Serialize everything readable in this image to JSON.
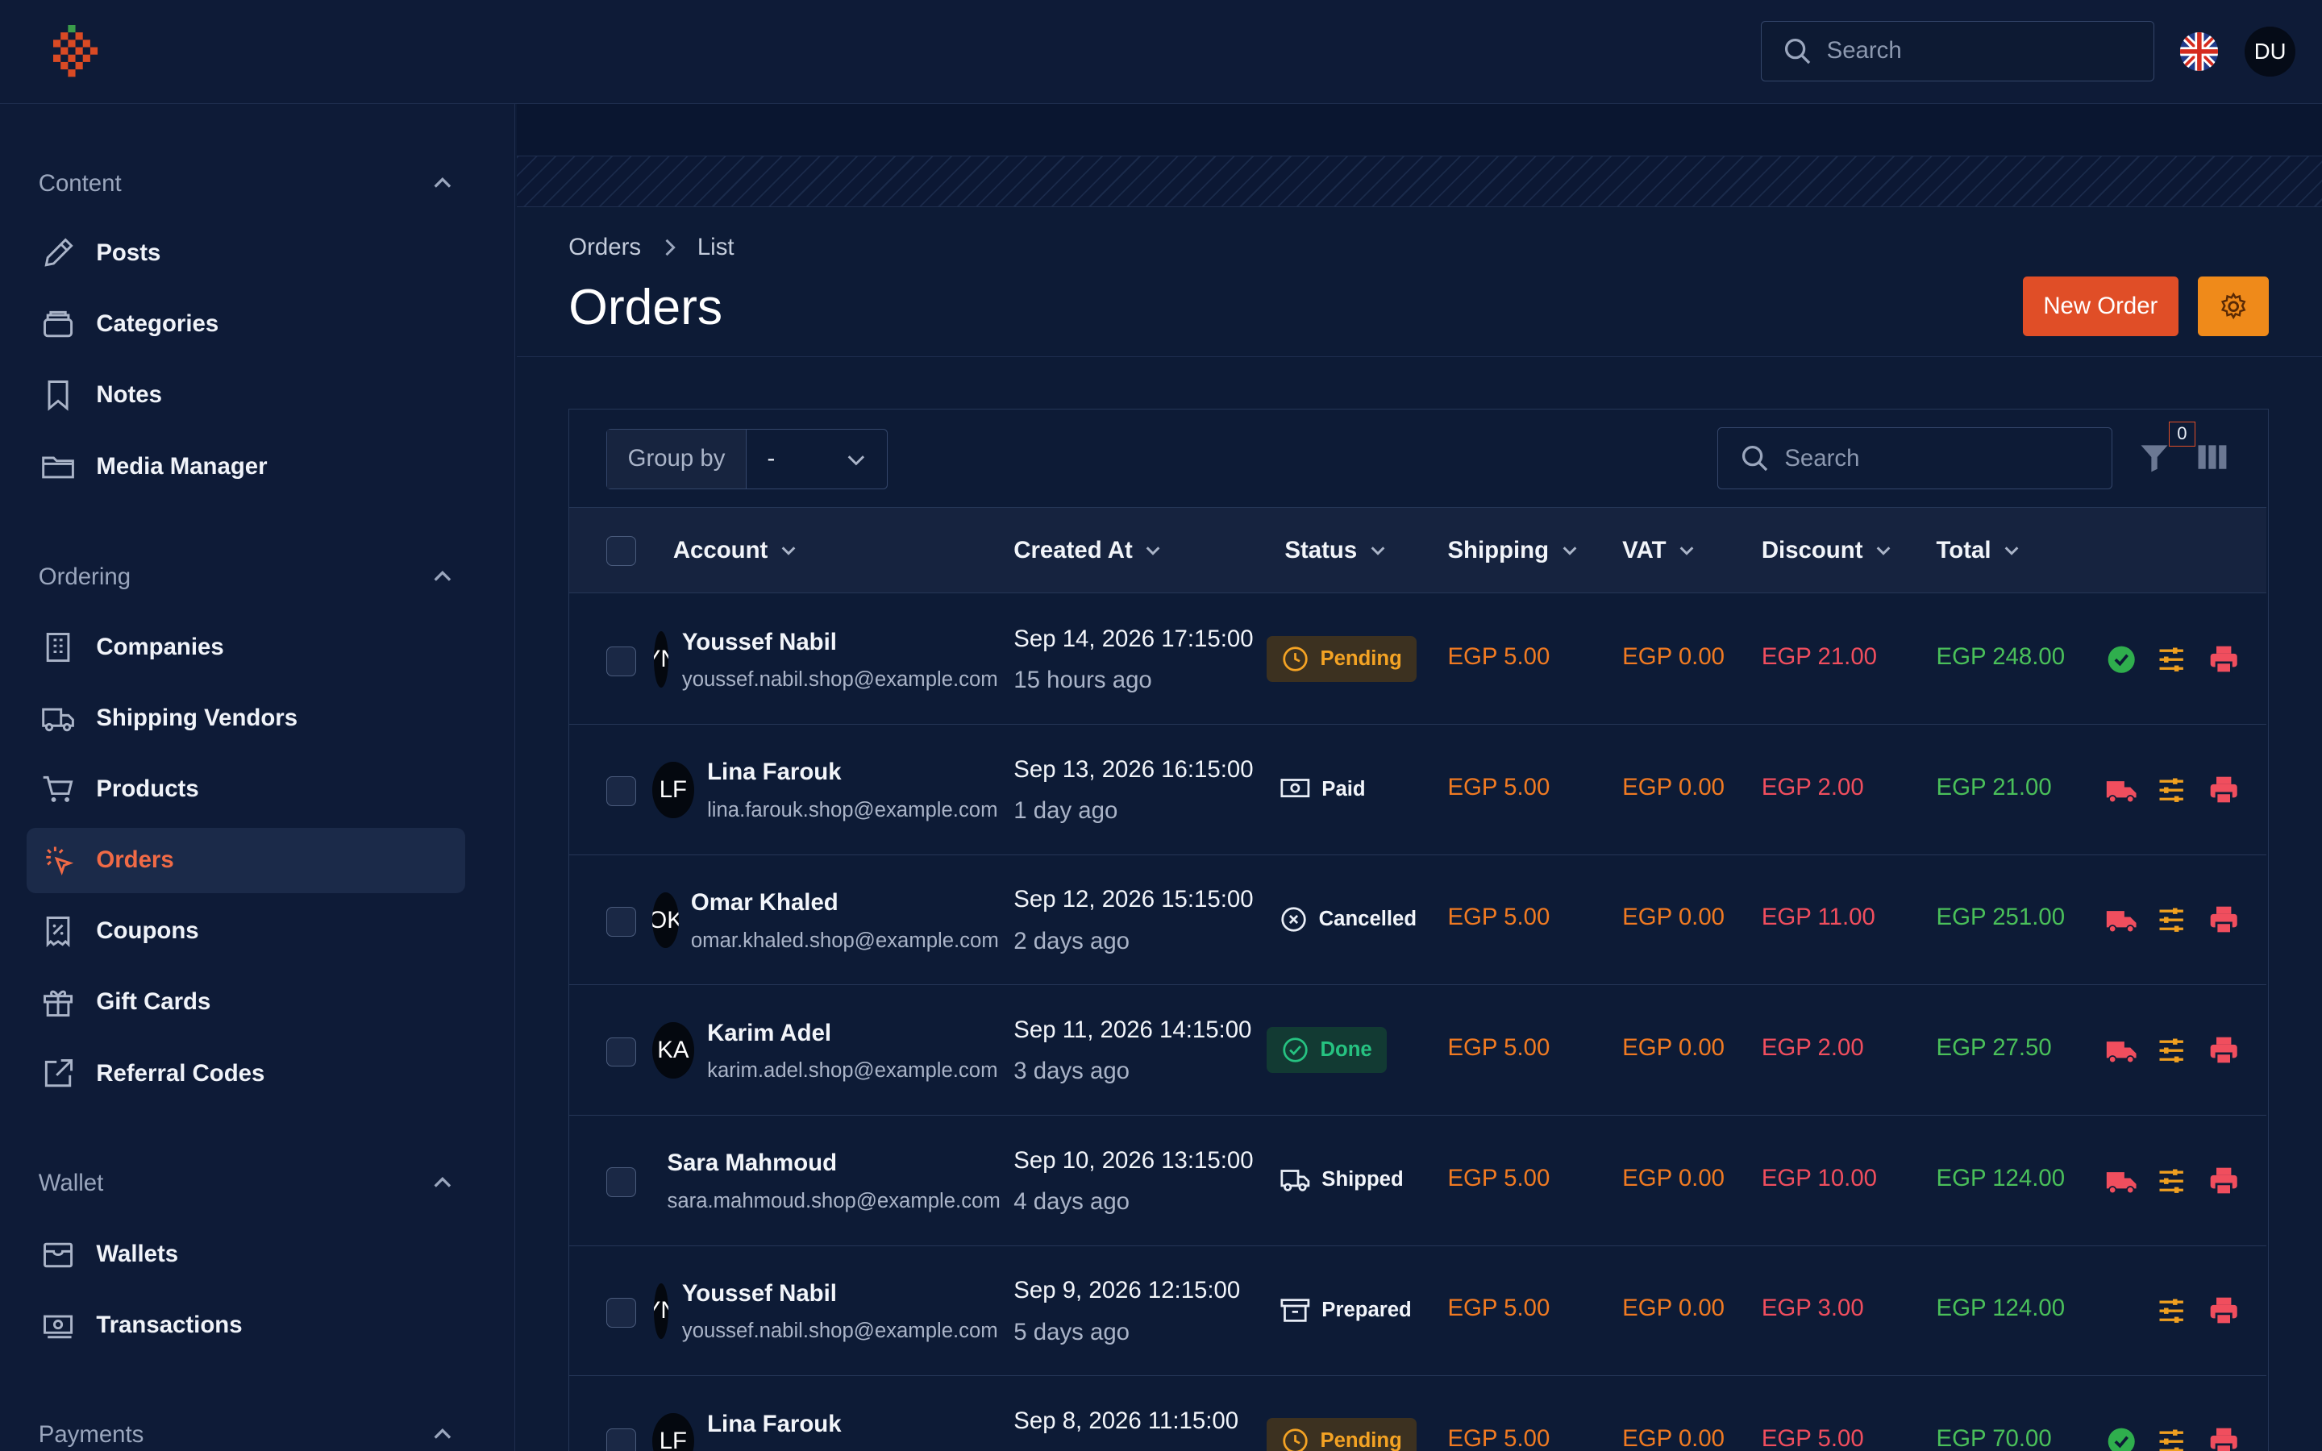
{
  "topbar": {
    "search_placeholder": "Search",
    "user_initials": "DU"
  },
  "sidebar": {
    "groups": [
      {
        "label": "Content",
        "items": [
          "Posts",
          "Categories",
          "Notes",
          "Media Manager"
        ]
      },
      {
        "label": "Ordering",
        "items": [
          "Companies",
          "Shipping Vendors",
          "Products",
          "Orders",
          "Coupons",
          "Gift Cards",
          "Referral Codes"
        ]
      },
      {
        "label": "Wallet",
        "items": [
          "Wallets",
          "Transactions"
        ]
      },
      {
        "label": "Payments",
        "items": []
      }
    ],
    "active_item": "Orders"
  },
  "breadcrumb": [
    "Orders",
    "List"
  ],
  "page_title": "Orders",
  "actions": {
    "new_order_label": "New Order"
  },
  "table": {
    "group_by_label": "Group by",
    "group_by_value": "-",
    "search_placeholder": "Search",
    "filter_count": "0",
    "columns": [
      "Account",
      "Created At",
      "Status",
      "Shipping",
      "VAT",
      "Discount",
      "Total"
    ],
    "rows": [
      {
        "avatar": "YN",
        "name": "Youssef Nabil",
        "email": "youssef.nabil.shop@example.com",
        "created": "Sep 14, 2026 17:15:00",
        "ago": "15 hours ago",
        "status": "Pending",
        "shipping": "EGP 5.00",
        "vat": "EGP 0.00",
        "discount": "EGP 21.00",
        "total": "EGP 248.00"
      },
      {
        "avatar": "LF",
        "name": "Lina Farouk",
        "email": "lina.farouk.shop@example.com",
        "created": "Sep 13, 2026 16:15:00",
        "ago": "1 day ago",
        "status": "Paid",
        "shipping": "EGP 5.00",
        "vat": "EGP 0.00",
        "discount": "EGP 2.00",
        "total": "EGP 21.00"
      },
      {
        "avatar": "OK",
        "name": "Omar Khaled",
        "email": "omar.khaled.shop@example.com",
        "created": "Sep 12, 2026 15:15:00",
        "ago": "2 days ago",
        "status": "Cancelled",
        "shipping": "EGP 5.00",
        "vat": "EGP 0.00",
        "discount": "EGP 11.00",
        "total": "EGP 251.00"
      },
      {
        "avatar": "KA",
        "name": "Karim Adel",
        "email": "karim.adel.shop@example.com",
        "created": "Sep 11, 2026 14:15:00",
        "ago": "3 days ago",
        "status": "Done",
        "shipping": "EGP 5.00",
        "vat": "EGP 0.00",
        "discount": "EGP 2.00",
        "total": "EGP 27.50"
      },
      {
        "avatar": "",
        "name": "Sara Mahmoud",
        "email": "sara.mahmoud.shop@example.com",
        "created": "Sep 10, 2026 13:15:00",
        "ago": "4 days ago",
        "status": "Shipped",
        "shipping": "EGP 5.00",
        "vat": "EGP 0.00",
        "discount": "EGP 10.00",
        "total": "EGP 124.00"
      },
      {
        "avatar": "YN",
        "name": "Youssef Nabil",
        "email": "youssef.nabil.shop@example.com",
        "created": "Sep 9, 2026 12:15:00",
        "ago": "5 days ago",
        "status": "Prepared",
        "shipping": "EGP 5.00",
        "vat": "EGP 0.00",
        "discount": "EGP 3.00",
        "total": "EGP 124.00"
      },
      {
        "avatar": "LF",
        "name": "Lina Farouk",
        "email": "",
        "created": "Sep 8, 2026 11:15:00",
        "ago": "",
        "status": "Pending",
        "shipping": "EGP 5.00",
        "vat": "EGP 0.00",
        "discount": "EGP 5.00",
        "total": "EGP 70.00"
      }
    ]
  },
  "colors": {
    "accent": "#e04e27",
    "settings": "#ef8a1a",
    "shipping": "#f07a22",
    "discount": "#f04e5e",
    "total": "#4ac05a"
  }
}
